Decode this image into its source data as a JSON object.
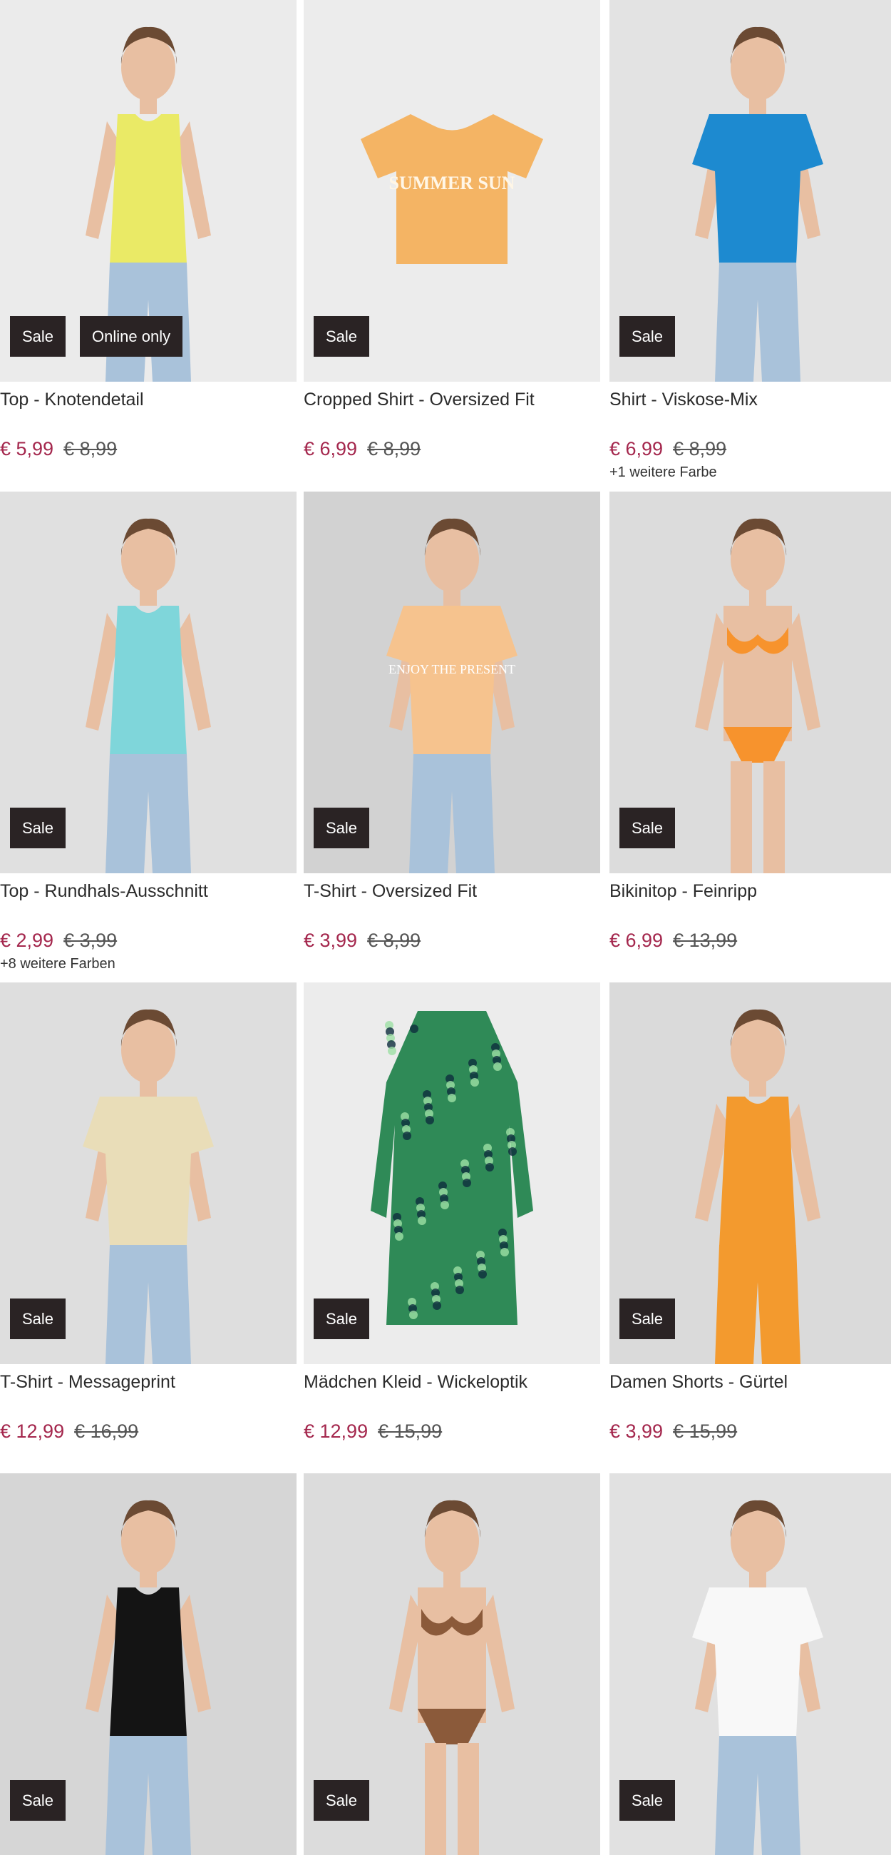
{
  "products": [
    {
      "title": "Top - Knotendetail",
      "price": "€ 5,99",
      "old_price": "€ 8,99",
      "badges": [
        "Sale",
        "Online only"
      ],
      "colors_note": "",
      "bg": "#ebebeb",
      "garment": "#eaea66",
      "type": "model-top"
    },
    {
      "title": "Cropped Shirt - Oversized Fit",
      "price": "€ 6,99",
      "old_price": "€ 8,99",
      "badges": [
        "Sale"
      ],
      "colors_note": "",
      "bg": "#ececec",
      "garment": "#f4b464",
      "type": "flat-tee",
      "print_text": "SUMMER SUN"
    },
    {
      "title": "Shirt - Viskose-Mix",
      "price": "€ 6,99",
      "old_price": "€ 8,99",
      "badges": [
        "Sale"
      ],
      "colors_note": "+1 weitere Farbe",
      "bg": "#e3e3e3",
      "garment": "#1d8ad0",
      "type": "model-tee"
    },
    {
      "title": "Top - Rundhals-Ausschnitt",
      "price": "€ 2,99",
      "old_price": "€ 3,99",
      "badges": [
        "Sale"
      ],
      "colors_note": "+8 weitere Farben",
      "bg": "#e0e0e0",
      "garment": "#7fd6da",
      "type": "model-top"
    },
    {
      "title": "T-Shirt - Oversized Fit",
      "price": "€ 3,99",
      "old_price": "€ 8,99",
      "badges": [
        "Sale"
      ],
      "colors_note": "",
      "bg": "#d2d2d2",
      "garment": "#f6c38e",
      "type": "model-tee",
      "print_text": "ENJOY THE PRESENT"
    },
    {
      "title": "Bikinitop - Feinripp",
      "price": "€ 6,99",
      "old_price": "€ 13,99",
      "badges": [
        "Sale"
      ],
      "colors_note": "",
      "bg": "#dcdcdc",
      "garment": "#f7932d",
      "type": "model-bikini"
    },
    {
      "title": "T-Shirt - Messageprint",
      "price": "€ 12,99",
      "old_price": "€ 16,99",
      "badges": [
        "Sale"
      ],
      "colors_note": "",
      "bg": "#dedede",
      "garment": "#e9ddb8",
      "type": "model-tee"
    },
    {
      "title": "Mädchen Kleid - Wickeloptik",
      "price": "€ 12,99",
      "old_price": "€ 15,99",
      "badges": [
        "Sale"
      ],
      "colors_note": "",
      "bg": "#ececec",
      "garment": "#2f8a57",
      "type": "flat-dress"
    },
    {
      "title": "Damen Shorts - Gürtel",
      "price": "€ 3,99",
      "old_price": "€ 15,99",
      "badges": [
        "Sale"
      ],
      "colors_note": "",
      "bg": "#dadada",
      "garment": "#f39a2e",
      "type": "model-shorts"
    },
    {
      "title": "",
      "price": "",
      "old_price": "",
      "badges": [
        "Sale"
      ],
      "colors_note": "",
      "bg": "#d6d6d6",
      "garment": "#141414",
      "type": "model-top"
    },
    {
      "title": "",
      "price": "",
      "old_price": "",
      "badges": [
        "Sale"
      ],
      "colors_note": "",
      "bg": "#dcdcdc",
      "garment": "#8b5a3a",
      "type": "model-bikini"
    },
    {
      "title": "",
      "price": "",
      "old_price": "",
      "badges": [
        "Sale"
      ],
      "colors_note": "",
      "bg": "#e1e1e1",
      "garment": "#f8f8f8",
      "type": "model-tee"
    }
  ],
  "colors": {
    "sale_price": "#a4274d",
    "badge_bg": "#2a2324",
    "badge_text": "#ffffff",
    "skin": "#e8bfa2",
    "denim": "#a9c2da"
  }
}
